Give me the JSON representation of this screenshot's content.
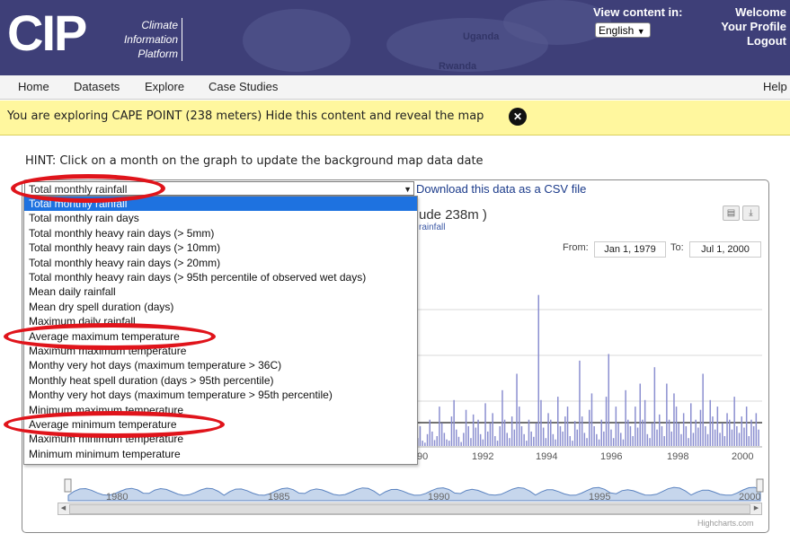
{
  "header": {
    "logo_text": "CIP",
    "logo_sub": [
      "Climate",
      "Information",
      "Platform"
    ],
    "map_labels": [
      "Uganda",
      "Rwanda"
    ],
    "view_content_label": "View content in:",
    "language": "English",
    "welcome": "Welcome",
    "profile": "Your Profile",
    "logout": "Logout"
  },
  "nav": {
    "items": [
      "Home",
      "Datasets",
      "Explore",
      "Case Studies"
    ],
    "help": "Help"
  },
  "banner": {
    "text": "You are exploring CAPE POINT (238 meters) Hide this content and reveal the map"
  },
  "hint": "HINT: Click on a month on the graph to update the background map data date",
  "select": {
    "value": "Total monthly rainfall"
  },
  "csv_link": "Download this data as a CSV file",
  "chart": {
    "title": "ude 238m )",
    "subtitle": "rainfall",
    "from_label": "From:",
    "from_value": "Jan 1, 1979",
    "to_label": "To:",
    "to_value": "Jul 1, 2000",
    "credit": "Highcharts.com"
  },
  "dropdown_options": [
    "Total monthly rainfall",
    "Total monthly rain days",
    "Total monthly heavy rain days (> 5mm)",
    "Total monthly heavy rain days (> 10mm)",
    "Total monthly heavy rain days (> 20mm)",
    "Total monthly heavy rain days (> 95th percentile of observed wet days)",
    "Mean daily rainfall",
    "Mean dry spell duration (days)",
    "Maximum daily rainfall",
    "Average maximum temperature",
    "Maximum maximum temperature",
    "Monthy very hot days (maximum temperature > 36C)",
    "Monthly heat spell duration (days > 95th percentile)",
    "Monthy very hot days (maximum temperature > 95th percentile)",
    "Minimum maximum temperature",
    "Average minimum temperature",
    "Maximum minimum temperature",
    "Minimum minimum temperature"
  ],
  "chart_data": {
    "type": "bar",
    "x_ticks": [
      "90",
      "1992",
      "1994",
      "1996",
      "1998",
      "2000"
    ],
    "navigator_ticks": [
      "1980",
      "1985",
      "1990",
      "1995",
      "2000"
    ],
    "series_color": "#8b8fd0",
    "values": [
      12,
      30,
      8,
      5,
      18,
      40,
      22,
      9,
      15,
      60,
      35,
      20,
      10,
      8,
      45,
      70,
      25,
      14,
      6,
      20,
      55,
      30,
      12,
      48,
      28,
      40,
      18,
      10,
      65,
      22,
      35,
      50,
      15,
      8,
      30,
      85,
      40,
      20,
      12,
      45,
      25,
      110,
      60,
      30,
      18,
      8,
      40,
      22,
      14,
      35,
      230,
      70,
      28,
      12,
      50,
      40,
      18,
      10,
      75,
      30,
      22,
      45,
      60,
      15,
      8,
      38,
      25,
      130,
      45,
      20,
      12,
      55,
      80,
      30,
      18,
      10,
      40,
      22,
      75,
      140,
      25,
      12,
      60,
      35,
      20,
      10,
      85,
      40,
      30,
      15,
      60,
      28,
      95,
      40,
      70,
      18,
      12,
      35,
      120,
      25,
      48,
      30,
      15,
      95,
      40,
      22,
      80,
      60,
      35,
      18,
      50,
      30,
      12,
      65,
      20,
      40,
      28,
      55,
      110,
      30,
      18,
      70,
      45,
      25,
      60,
      20,
      35,
      15,
      50,
      40,
      25,
      75,
      30,
      20,
      45,
      28,
      60,
      15,
      40,
      30,
      50,
      25
    ]
  }
}
